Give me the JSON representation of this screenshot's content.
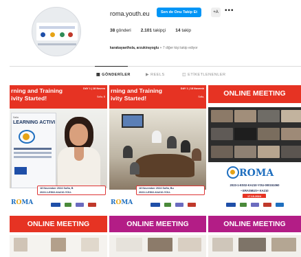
{
  "profile": {
    "username": "roma.youth.eu",
    "follow_button": "Sen de Onu Takip Et",
    "add_user_icon": "+A",
    "more_icon": "•••",
    "posts_count": "38",
    "posts_label": "gönderi",
    "followers_count": "2.101",
    "followers_label": "takipçi",
    "following_count": "14",
    "following_label": "takip",
    "followed_by_names": "karakayaethsla, arzukirayoglu",
    "followed_by_suffix": "+ 7 diğer kişi takip ediyor"
  },
  "tabs": {
    "posts": {
      "label": "GÖNDERİLER",
      "icon": "grid-icon"
    },
    "reels": {
      "label": "REELS",
      "icon": "reels-icon"
    },
    "tagged": {
      "label": "ETİKETLENENLER",
      "icon": "tagged-icon"
    }
  },
  "posts": [
    {
      "title_line1": "rning and Training",
      "title_line2": "ivity Started!",
      "day": "DAY 1 | 18 Novem",
      "date": "Sofia, B",
      "banner_sub": "Salia",
      "banner_title": "LEARNING ACTIVI",
      "info_line1": "18 November 2024 Sofia, B",
      "info_line2": "2023-1-ES02-KA210-YOU-"
    },
    {
      "title_line1": "rning and Training",
      "title_line2": "ivity Started!",
      "day": "DAY 1 | 18 Novemb",
      "date": "Sofia,",
      "info_line1": "18 November 2024 Sofia, Bu",
      "info_line2": "2023-1-ES02-KA210-YOU-"
    },
    {
      "title": "ONLINE MEETING",
      "logo_text": "ROMA",
      "code": "2023-1-ES02-KA210-YOU-000151060",
      "program": "• ERASMUS+ KA210",
      "date": "17.10.2024"
    },
    {
      "title": "ONLINE MEETING"
    },
    {
      "title": "ONLINE MEETING"
    },
    {
      "title": "ONLINE MEETING"
    }
  ],
  "colors": {
    "follow_blue": "#0095f6",
    "header_red": "#e63323",
    "header_magenta": "#b31d86",
    "roma_blue": "#1f6fbf",
    "roma_gold": "#e6a316"
  }
}
